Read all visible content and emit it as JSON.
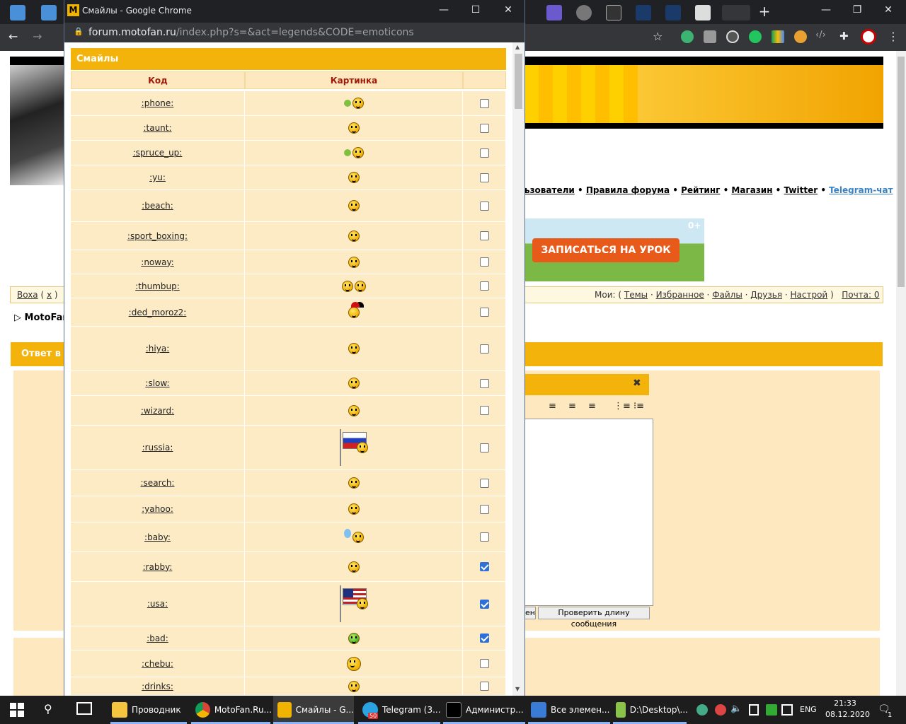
{
  "bg_browser": {
    "links_text": "ьзователи",
    "links": [
      "Правила форума",
      "Рейтинг",
      "Магазин",
      "Twitter",
      "Telegram-чат"
    ],
    "ad_button": "ЗАПИСАТЬСЯ НА УРОК",
    "ad_age": "0+",
    "nav_left_user": "Boxa",
    "nav_left_x": "x",
    "nav_right_prefix": "Мои: (",
    "nav_right_items": [
      "Темы",
      "Избранное",
      "Файлы",
      "Друзья",
      "Настрой"
    ],
    "nav_right_suffix": ")",
    "nav_mail": "Почта: 0",
    "crumb": "MotoFan",
    "reply_title": "Ответ в",
    "editor_btn_partial": "ен",
    "editor_btn_check": "Проверить длину сообщения"
  },
  "popup": {
    "window_title": "Смайлы - Google Chrome",
    "logo": "M",
    "url_domain": "forum.motofan.ru",
    "url_path": "/index.php?s=&act=legends&CODE=emoticons",
    "table_title": "Смайлы",
    "col_code": "Код",
    "col_picture": "Картинка",
    "rows": [
      {
        "code": ":phone:",
        "checked": false
      },
      {
        "code": ":taunt:",
        "checked": false
      },
      {
        "code": ":spruce_up:",
        "checked": false
      },
      {
        "code": ":yu:",
        "checked": false
      },
      {
        "code": ":beach:",
        "checked": false
      },
      {
        "code": ":sport_boxing:",
        "checked": false
      },
      {
        "code": ":noway:",
        "checked": false
      },
      {
        "code": ":thumbup:",
        "checked": false
      },
      {
        "code": ":ded_moroz2:",
        "checked": false
      },
      {
        "code": ":hiya:",
        "checked": false
      },
      {
        "code": ":slow:",
        "checked": false
      },
      {
        "code": ":wizard:",
        "checked": false
      },
      {
        "code": ":russia:",
        "checked": false
      },
      {
        "code": ":search:",
        "checked": false
      },
      {
        "code": ":yahoo:",
        "checked": false
      },
      {
        "code": ":baby:",
        "checked": false
      },
      {
        "code": ":rabby:",
        "checked": true
      },
      {
        "code": ":usa:",
        "checked": true
      },
      {
        "code": ":bad:",
        "checked": true
      },
      {
        "code": ":chebu:",
        "checked": false
      },
      {
        "code": ":drinks:",
        "checked": false
      }
    ]
  },
  "taskbar": {
    "items": [
      "Проводник",
      "MotoFan.Ru...",
      "Смайлы - G...",
      "Telegram (3...",
      "Администр...",
      "Все элемен...",
      "D:\\Desktop\\..."
    ],
    "telegram_badge": "50",
    "lang": "ENG",
    "time": "21:33",
    "date": "08.12.2020",
    "notif_count": "1"
  },
  "colors": {
    "accent": "#f3b30a",
    "row_bg": "#fdebc6",
    "header_text": "#a0190a",
    "checkbox_on": "#2f6fd8"
  }
}
